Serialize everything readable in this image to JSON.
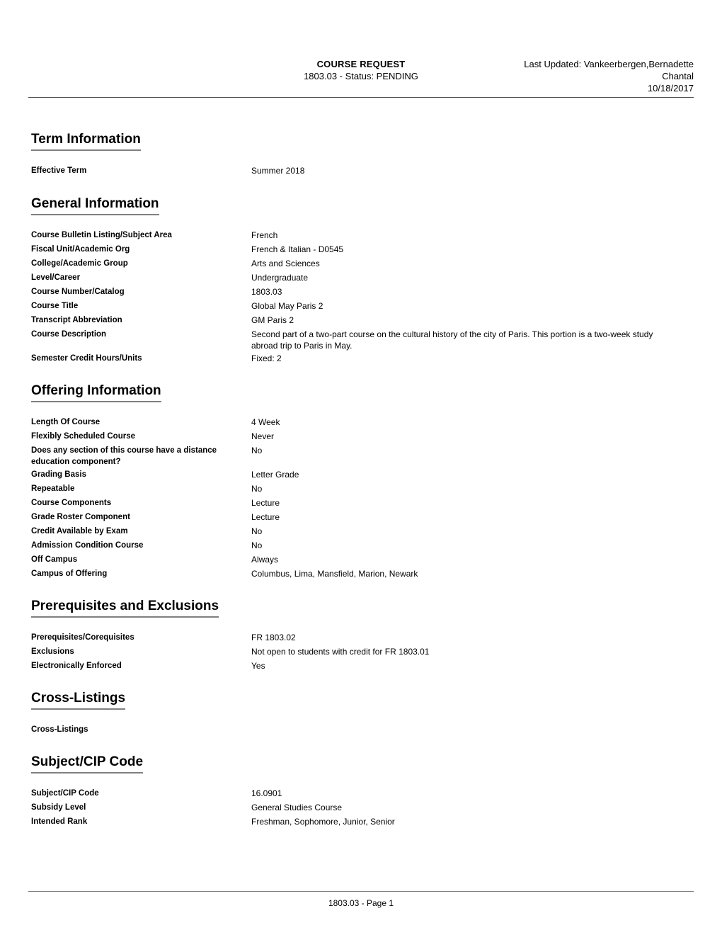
{
  "header": {
    "title": "COURSE REQUEST",
    "subtitle": "1803.03 - Status: PENDING",
    "last_updated_line1": "Last Updated: Vankeerbergen,Bernadette",
    "last_updated_line2": "Chantal",
    "last_updated_date": "10/18/2017"
  },
  "sections": [
    {
      "title": "Term Information",
      "rows": [
        {
          "label": "Effective Term",
          "value": "Summer 2018"
        }
      ]
    },
    {
      "title": "General Information",
      "rows": [
        {
          "label": "Course Bulletin Listing/Subject Area",
          "value": "French"
        },
        {
          "label": "Fiscal Unit/Academic Org",
          "value": "French & Italian - D0545"
        },
        {
          "label": "College/Academic Group",
          "value": "Arts and Sciences"
        },
        {
          "label": "Level/Career",
          "value": "Undergraduate"
        },
        {
          "label": "Course Number/Catalog",
          "value": "1803.03"
        },
        {
          "label": "Course Title",
          "value": "Global May Paris 2"
        },
        {
          "label": "Transcript Abbreviation",
          "value": "GM Paris 2"
        },
        {
          "label": "Course Description",
          "value": "Second part of a two-part course on the cultural history of the city of Paris. This portion is a two-week study abroad trip to Paris in May."
        },
        {
          "label": "Semester Credit Hours/Units",
          "value": "Fixed: 2"
        }
      ]
    },
    {
      "title": "Offering Information",
      "rows": [
        {
          "label": "Length Of Course",
          "value": "4 Week"
        },
        {
          "label": "Flexibly Scheduled Course",
          "value": "Never"
        },
        {
          "label": "Does any section of this course have a distance education component?",
          "value": "No"
        },
        {
          "label": "Grading Basis",
          "value": "Letter Grade"
        },
        {
          "label": "Repeatable",
          "value": "No"
        },
        {
          "label": "Course Components",
          "value": "Lecture"
        },
        {
          "label": "Grade Roster Component",
          "value": "Lecture"
        },
        {
          "label": "Credit Available by Exam",
          "value": "No"
        },
        {
          "label": "Admission Condition Course",
          "value": "No"
        },
        {
          "label": "Off Campus",
          "value": "Always"
        },
        {
          "label": "Campus of Offering",
          "value": "Columbus, Lima, Mansfield, Marion, Newark"
        }
      ]
    },
    {
      "title": "Prerequisites and Exclusions",
      "rows": [
        {
          "label": "Prerequisites/Corequisites",
          "value": "FR 1803.02"
        },
        {
          "label": "Exclusions",
          "value": "Not open to students with credit for FR 1803.01"
        },
        {
          "label": "Electronically Enforced",
          "value": "Yes"
        }
      ]
    },
    {
      "title": "Cross-Listings",
      "rows": [
        {
          "label": "Cross-Listings",
          "value": ""
        }
      ]
    },
    {
      "title": "Subject/CIP Code",
      "rows": [
        {
          "label": "Subject/CIP Code",
          "value": "16.0901"
        },
        {
          "label": "Subsidy Level",
          "value": "General Studies Course"
        },
        {
          "label": "Intended Rank",
          "value": "Freshman, Sophomore, Junior, Senior"
        }
      ]
    }
  ],
  "footer": {
    "page_text": "1803.03 - Page 1"
  }
}
